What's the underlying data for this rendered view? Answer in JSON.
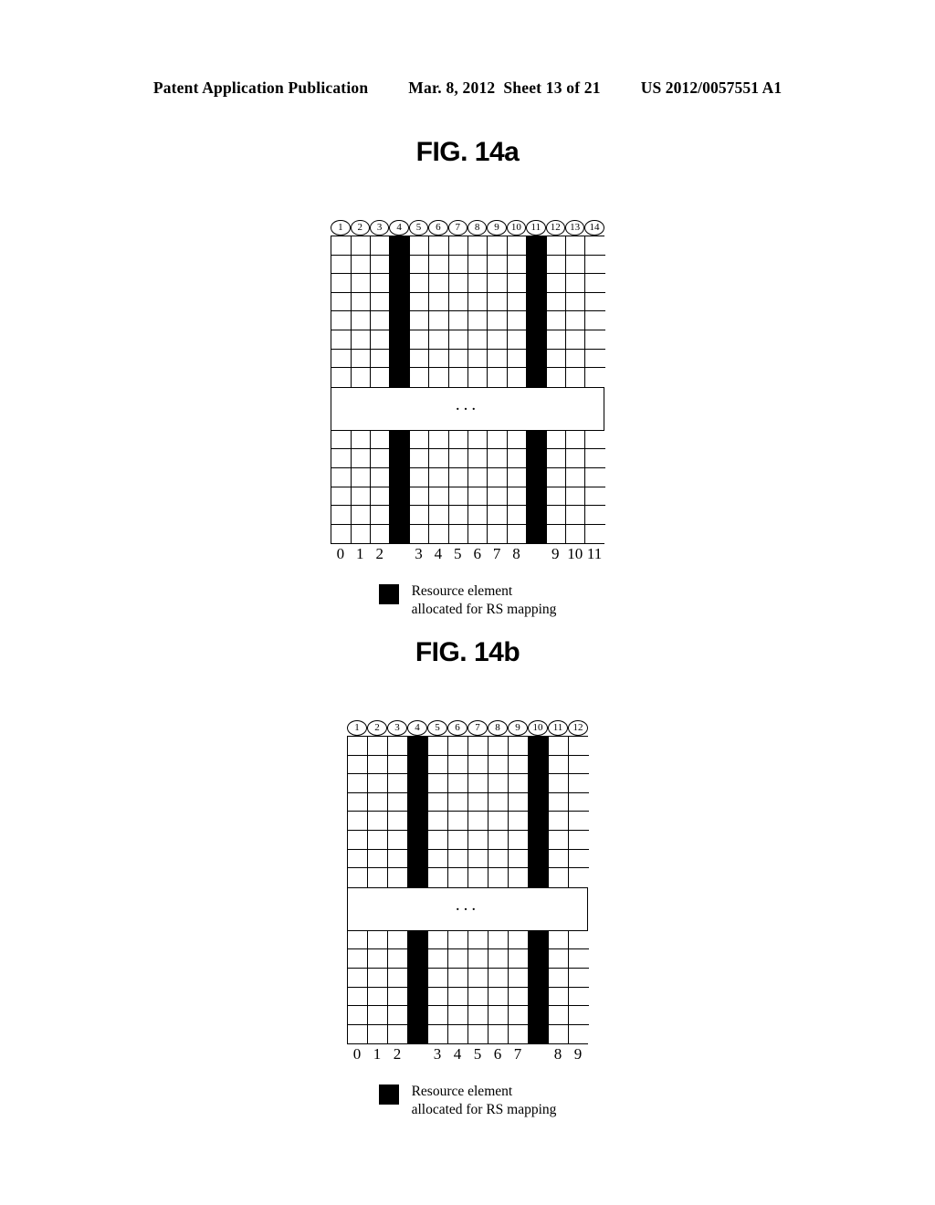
{
  "header": {
    "publication": "Patent Application Publication",
    "date": "Mar. 8, 2012",
    "sheet": "Sheet 13 of 21",
    "patent_number": "US 2012/0057551 A1"
  },
  "figures": [
    {
      "title": "FIG. 14a",
      "circled_numbers": [
        "1",
        "2",
        "3",
        "4",
        "5",
        "6",
        "7",
        "8",
        "9",
        "10",
        "11",
        "12",
        "13",
        "14"
      ],
      "columns": 14,
      "rs_columns": [
        3,
        10
      ],
      "upper_rows": 8,
      "lower_rows": 6,
      "ellipsis": "...",
      "axis_labels": [
        "0",
        "1",
        "2",
        "3",
        "4",
        "5",
        "6",
        "7",
        "8",
        "9",
        "10",
        "11"
      ],
      "legend": {
        "swatch_color": "#000000",
        "text": "Resource element\nallocated for RS mapping"
      }
    },
    {
      "title": "FIG. 14b",
      "circled_numbers": [
        "1",
        "2",
        "3",
        "4",
        "5",
        "6",
        "7",
        "8",
        "9",
        "10",
        "11",
        "12"
      ],
      "columns": 12,
      "rs_columns": [
        3,
        9
      ],
      "upper_rows": 8,
      "lower_rows": 6,
      "ellipsis": "...",
      "axis_labels": [
        "0",
        "1",
        "2",
        "3",
        "4",
        "5",
        "6",
        "7",
        "8",
        "9"
      ],
      "legend": {
        "swatch_color": "#000000",
        "text": "Resource element\nallocated for RS mapping"
      }
    }
  ]
}
